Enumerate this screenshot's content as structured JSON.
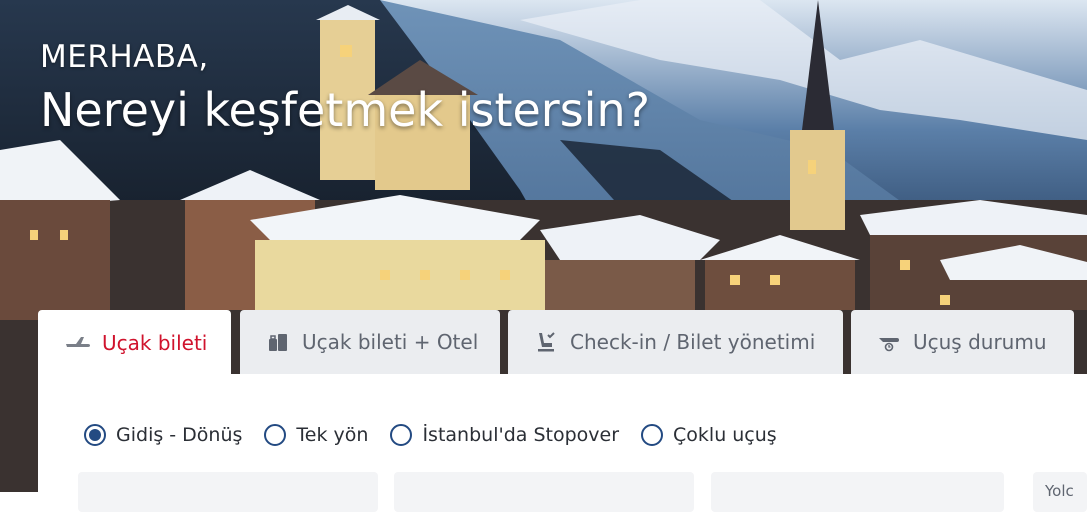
{
  "hero": {
    "greeting": "MERHABA,",
    "headline": "Nereyi keşfetmek istersin?"
  },
  "tabs": [
    {
      "label": "Uçak bileti",
      "icon": "plane-icon",
      "active": true
    },
    {
      "label": "Uçak bileti + Otel",
      "icon": "hotel-luggage-icon",
      "active": false
    },
    {
      "label": "Check-in / Bilet yönetimi",
      "icon": "seat-checkin-icon",
      "active": false
    },
    {
      "label": "Uçuş durumu",
      "icon": "flight-status-icon",
      "active": false
    }
  ],
  "trip_types": [
    {
      "label": "Gidiş - Dönüş",
      "selected": true
    },
    {
      "label": "Tek yön",
      "selected": false
    },
    {
      "label": "İstanbul'da Stopover",
      "selected": false
    },
    {
      "label": "Çoklu uçuş",
      "selected": false
    }
  ],
  "search_form": {
    "partial_label": "Yolc"
  },
  "colors": {
    "accent_red": "#d0132d",
    "radio_blue": "#234a82",
    "tab_bg": "#ebedf0"
  }
}
